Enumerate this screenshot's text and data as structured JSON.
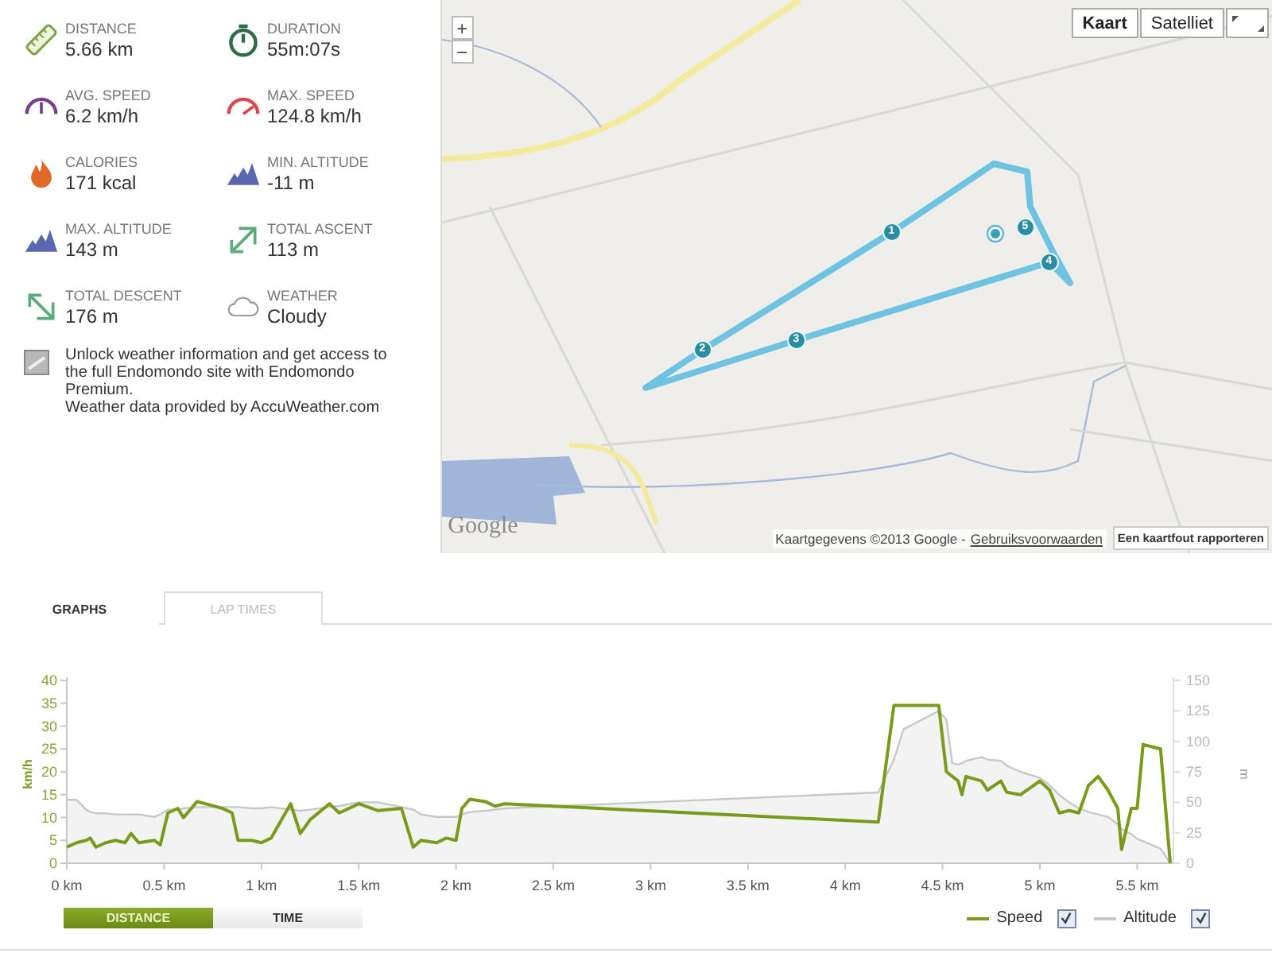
{
  "stats": [
    {
      "kind": "ruler",
      "label": "DISTANCE",
      "value": "5.66 km"
    },
    {
      "kind": "stopwatch",
      "label": "DURATION",
      "value": "55m:07s"
    },
    {
      "kind": "gauge-avg",
      "label": "AVG. SPEED",
      "value": "6.2 km/h"
    },
    {
      "kind": "gauge-max",
      "label": "MAX. SPEED",
      "value": "124.8 km/h"
    },
    {
      "kind": "flame",
      "label": "CALORIES",
      "value": "171 kcal"
    },
    {
      "kind": "mountain",
      "label": "MIN. ALTITUDE",
      "value": "-11 m"
    },
    {
      "kind": "mountain",
      "label": "MAX. ALTITUDE",
      "value": "143 m"
    },
    {
      "kind": "ascent",
      "label": "TOTAL ASCENT",
      "value": "113 m"
    },
    {
      "kind": "descent",
      "label": "TOTAL DESCENT",
      "value": "176 m"
    },
    {
      "kind": "cloud",
      "label": "WEATHER",
      "value": "Cloudy"
    }
  ],
  "promo": {
    "text": "Unlock weather information and get access to the full Endomondo site with Endomondo Premium.",
    "credit": "Weather data provided by AccuWeather.com"
  },
  "map": {
    "kind": "picture",
    "zoom_in": "+",
    "zoom_out": "−",
    "map_types": [
      {
        "label": "Kaart",
        "selected": true
      },
      {
        "label": "Satelliet",
        "selected": false
      }
    ],
    "lap_markers": [
      "1",
      "2",
      "3",
      "4",
      "5"
    ],
    "logo": "Google",
    "attribution": "Kaartgegevens ©2013 Google -",
    "terms_link": "Gebruiksvoorwaarden",
    "report_button": "Een kaartfout rapporteren"
  },
  "tabs": [
    {
      "label": "GRAPHS",
      "selected": true
    },
    {
      "label": "LAP TIMES",
      "selected": false
    }
  ],
  "chart": {
    "chart_data": {
      "type": "line",
      "ylabel": "km/h",
      "y2label": "m",
      "xlim": [
        0,
        5.67
      ],
      "x": [
        0,
        0.05,
        0.1,
        0.12,
        0.15,
        0.2,
        0.25,
        0.3,
        0.33,
        0.37,
        0.45,
        0.48,
        0.52,
        0.57,
        0.6,
        0.67,
        0.8,
        0.85,
        0.88,
        0.95,
        1.0,
        1.05,
        1.15,
        1.2,
        1.25,
        1.35,
        1.4,
        1.5,
        1.6,
        1.72,
        1.78,
        1.82,
        1.9,
        1.95,
        2.0,
        2.03,
        2.07,
        2.15,
        2.2,
        2.25,
        4.17,
        4.25,
        4.3,
        4.48,
        4.52,
        4.55,
        4.58,
        4.6,
        4.62,
        4.7,
        4.73,
        4.8,
        4.83,
        4.9,
        5.0,
        5.05,
        5.1,
        5.15,
        5.2,
        5.25,
        5.3,
        5.35,
        5.4,
        5.42,
        5.47,
        5.5,
        5.53,
        5.62,
        5.67
      ],
      "series": [
        {
          "name": "Speed",
          "color": "#7a9a1c",
          "values": [
            3.5,
            4.5,
            5,
            5.5,
            3.5,
            4.5,
            5,
            4.5,
            6.5,
            4.5,
            5,
            4,
            11,
            12,
            10,
            13.5,
            12,
            11,
            5,
            5,
            4.5,
            5.5,
            13,
            6.5,
            9.5,
            13,
            11,
            13,
            11.5,
            12,
            3.5,
            5,
            4.5,
            5.5,
            5,
            12,
            14,
            13.5,
            12.5,
            13,
            9,
            34.5,
            34.5,
            34.5,
            20,
            19,
            18,
            15,
            19,
            18,
            16,
            18,
            15.5,
            15,
            18,
            16,
            11,
            11.5,
            11,
            17,
            19,
            16,
            12,
            3,
            12,
            12,
            26,
            25,
            0
          ]
        },
        {
          "name": "Altitude",
          "color": "#c8c8c8",
          "axis": "y2",
          "values": [
            52,
            52,
            44,
            42,
            41,
            41,
            40,
            40,
            40,
            40,
            38,
            40,
            44,
            44,
            45,
            46,
            46,
            46,
            46,
            45,
            45,
            46,
            44,
            43,
            44,
            46,
            47,
            50,
            50,
            46,
            44,
            40,
            38,
            38,
            38,
            40,
            42,
            43,
            44,
            45,
            58,
            85,
            110,
            125,
            118,
            82,
            81,
            82,
            84,
            87,
            85,
            84,
            80,
            75,
            70,
            64,
            56,
            50,
            45,
            42,
            40,
            38,
            32,
            28,
            24,
            20,
            18,
            12,
            0
          ]
        }
      ],
      "xticks": [
        {
          "value": 0,
          "label": "0 km"
        },
        {
          "value": 0.5,
          "label": "0.5 km"
        },
        {
          "value": 1,
          "label": "1 km"
        },
        {
          "value": 1.5,
          "label": "1.5 km"
        },
        {
          "value": 2,
          "label": "2 km"
        },
        {
          "value": 2.5,
          "label": "2.5 km"
        },
        {
          "value": 3,
          "label": "3 km"
        },
        {
          "value": 3.5,
          "label": "3.5 km"
        },
        {
          "value": 4,
          "label": "4 km"
        },
        {
          "value": 4.5,
          "label": "4.5 km"
        },
        {
          "value": 5,
          "label": "5 km"
        },
        {
          "value": 5.5,
          "label": "5.5 km"
        }
      ],
      "yticks": [
        0,
        5,
        10,
        15,
        20,
        25,
        30,
        35,
        40
      ],
      "ylim": [
        0,
        40
      ],
      "y2ticks": [
        0,
        25,
        50,
        75,
        100,
        125,
        150
      ],
      "y2lim": [
        0,
        150
      ]
    }
  },
  "x_toggle": [
    {
      "label": "DISTANCE",
      "selected": true
    },
    {
      "label": "TIME",
      "selected": false
    }
  ],
  "legend": [
    {
      "checked": true
    },
    {
      "checked": true
    }
  ]
}
